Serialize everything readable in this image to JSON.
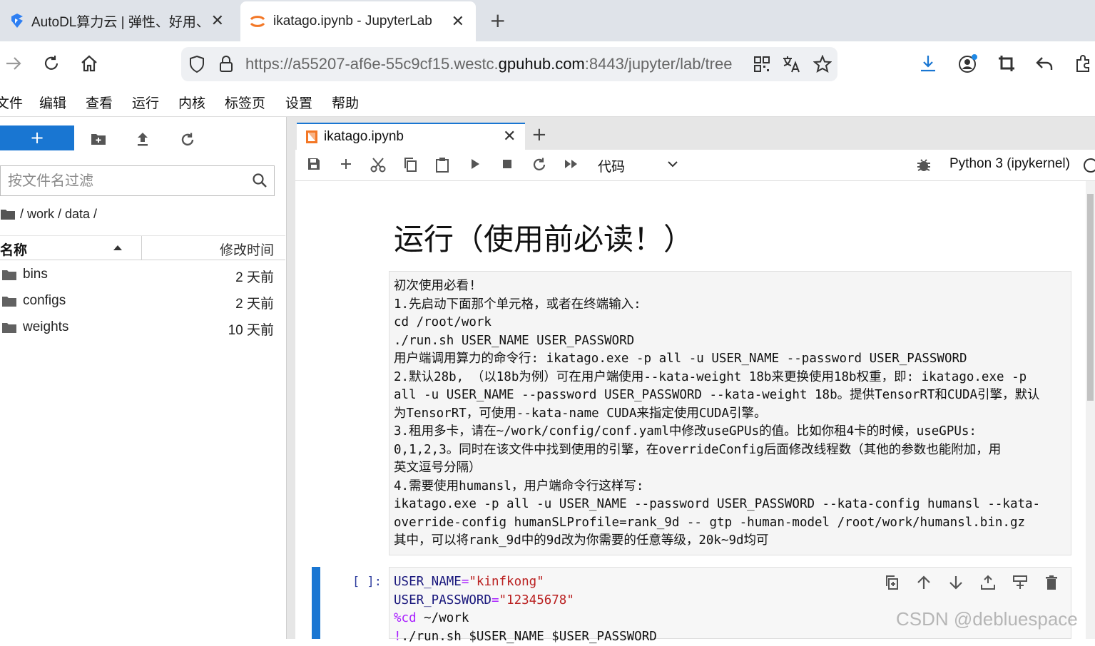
{
  "browser": {
    "tabs": [
      {
        "title": "AutoDL算力云 | 弹性、好用、省",
        "close": "✕"
      },
      {
        "title": "ikatago.ipynb - JupyterLab",
        "close": "✕"
      }
    ],
    "new_tab": "+",
    "url_prefix": "https://a55207-af6e-55c9cf15.westc.",
    "url_domain": "gpuhub.com",
    "url_suffix": ":8443/jupyter/lab/tree"
  },
  "menu": [
    "文件",
    "编辑",
    "查看",
    "运行",
    "内核",
    "标签页",
    "设置",
    "帮助"
  ],
  "filebrowser": {
    "new_label": "+",
    "filter_placeholder": "按文件名过滤",
    "breadcrumb": "/ work / data /",
    "col_name": "名称",
    "col_modified": "修改时间",
    "files": [
      {
        "name": "bins",
        "modified": "2 天前"
      },
      {
        "name": "configs",
        "modified": "2 天前"
      },
      {
        "name": "weights",
        "modified": "10 天前"
      }
    ]
  },
  "notebook": {
    "tab_title": "ikatago.ipynb",
    "tab_close": "✕",
    "add_tab": "+",
    "cell_type": "代码",
    "kernel": "Python 3 (ipykernel)",
    "heading": "运行（使用前必读！）",
    "markdown_lines": [
      "初次使用必看!",
      "1.先启动下面那个单元格，或者在终端输入:",
      "cd /root/work",
      "./run.sh USER_NAME USER_PASSWORD",
      "用户端调用算力的命令行: ikatago.exe -p all -u USER_NAME --password USER_PASSWORD",
      "2.默认28b, （以18b为例）可在用户端使用--kata-weight 18b来更换使用18b权重，即: ikatago.exe -p",
      "all -u USER_NAME --password USER_PASSWORD --kata-weight 18b。提供TensorRT和CUDA引擎，默认",
      "为TensorRT，可使用--kata-name CUDA来指定使用CUDA引擎。",
      "3.租用多卡，请在~/work/config/conf.yaml中修改useGPUs的值。比如你租4卡的时候，useGPUs:",
      "0,1,2,3。同时在该文件中找到使用的引擎，在overrideConfig后面修改线程数（其他的参数也能附加，用",
      "英文逗号分隔）",
      "4.需要使用humansl，用户端命令行这样写:",
      "ikatago.exe -p all -u USER_NAME --password USER_PASSWORD --kata-config humansl --kata-",
      "override-config humanSLProfile=rank_9d -- gtp -human-model /root/work/humansl.bin.gz",
      "其中，可以将rank_9d中的9d改为你需要的任意等级，20k~9d均可"
    ],
    "prompt": "[ ]:",
    "code": {
      "l1_var": "USER_NAME",
      "l1_eq": "=",
      "l1_str": "\"kinfkong\"",
      "l2_var": "USER_PASSWORD",
      "l2_eq": "=",
      "l2_str": "\"12345678\"",
      "l3_magic": "%cd",
      "l3_rest": " ~/work",
      "l4_bang": "!",
      "l4_rest": "./run.sh $USER_NAME $USER_PASSWORD"
    }
  },
  "watermark": "CSDN @debluespace",
  "colors": {
    "accent": "#1976d2",
    "prompt": "#303f9f",
    "string": "#ba2121",
    "magic": "#aa22ff"
  }
}
